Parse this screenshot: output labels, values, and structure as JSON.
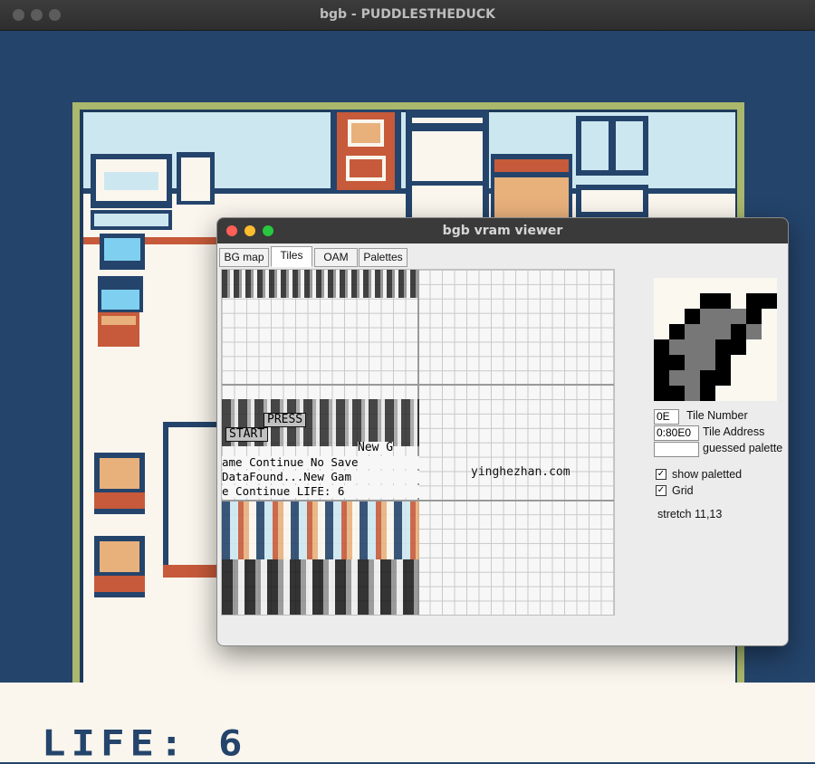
{
  "main_window": {
    "title": "bgb - PUDDLESTHEDUCK",
    "life_text": "LIFE: 6"
  },
  "vram_viewer": {
    "title": "bgb vram viewer",
    "tabs": [
      {
        "label": "BG map",
        "active": false
      },
      {
        "label": "Tiles",
        "active": true
      },
      {
        "label": "OAM",
        "active": false
      },
      {
        "label": "Palettes",
        "active": false
      }
    ],
    "tile_number": {
      "value": "0E",
      "label": "Tile Number"
    },
    "tile_address": {
      "value": "0:80E0",
      "label": "Tile Address"
    },
    "guessed_palette": {
      "value": "",
      "label": "guessed palette"
    },
    "show_paletted": {
      "label": "show paletted",
      "checked": true
    },
    "grid": {
      "label": "Grid",
      "checked": true
    },
    "stretch": "stretch 11,13",
    "tile_text_rows": [
      "PRESS",
      "START",
      "New G",
      "ame Continue No Save",
      " DataFound...New Gam",
      "e Continue LIFE: 6"
    ],
    "watermark": "yinghezhan.com"
  },
  "colors": {
    "navy": "#24446b",
    "cream": "#faf6ee",
    "light_blue": "#cde7f0",
    "green_border": "#a9b86c",
    "orange": "#c65a3a",
    "tan": "#e8b17c"
  }
}
